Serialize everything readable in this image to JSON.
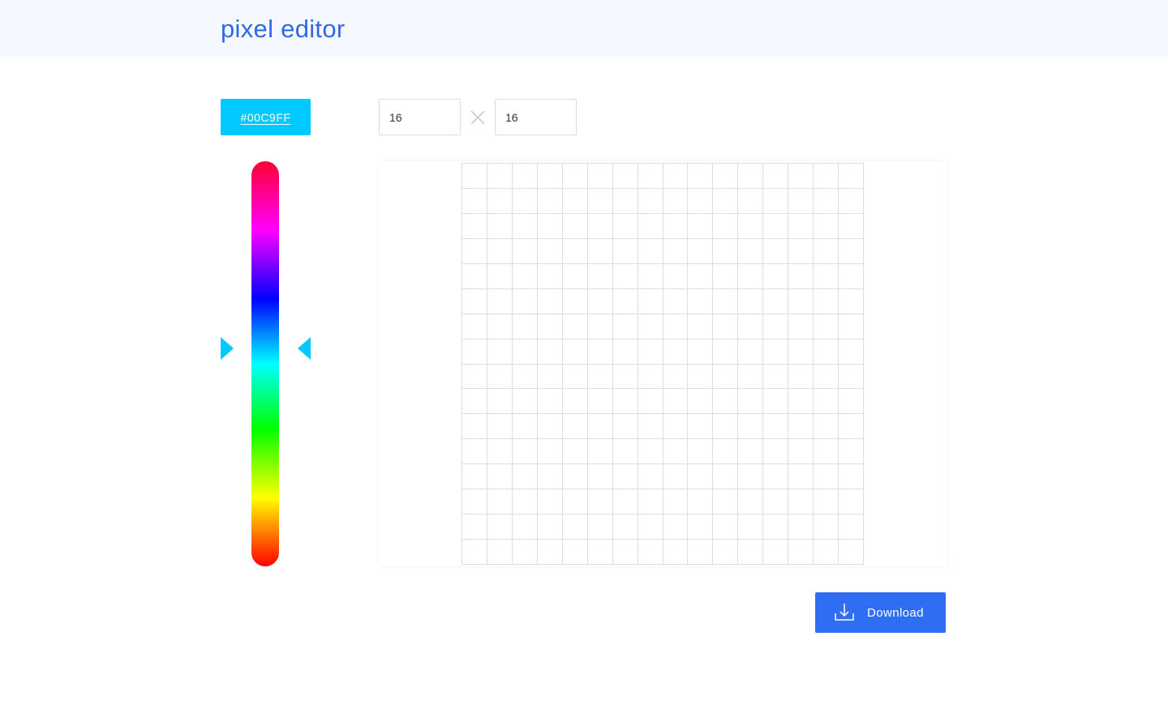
{
  "header": {
    "title": "pixel editor",
    "background": "#f5f8ff",
    "title_color": "#2f6ae6"
  },
  "color_picker": {
    "hex_label": "#00C9FF",
    "selected_color": "#00C9FF",
    "hue_fraction": 0.46
  },
  "grid_size": {
    "width_value": "16",
    "height_value": "16",
    "separator_icon": "times-icon"
  },
  "canvas": {
    "columns": 16,
    "rows": 16,
    "line_color": "#dddddd"
  },
  "download": {
    "label": "Download",
    "icon": "download-icon",
    "color": "#2f6ef2"
  }
}
